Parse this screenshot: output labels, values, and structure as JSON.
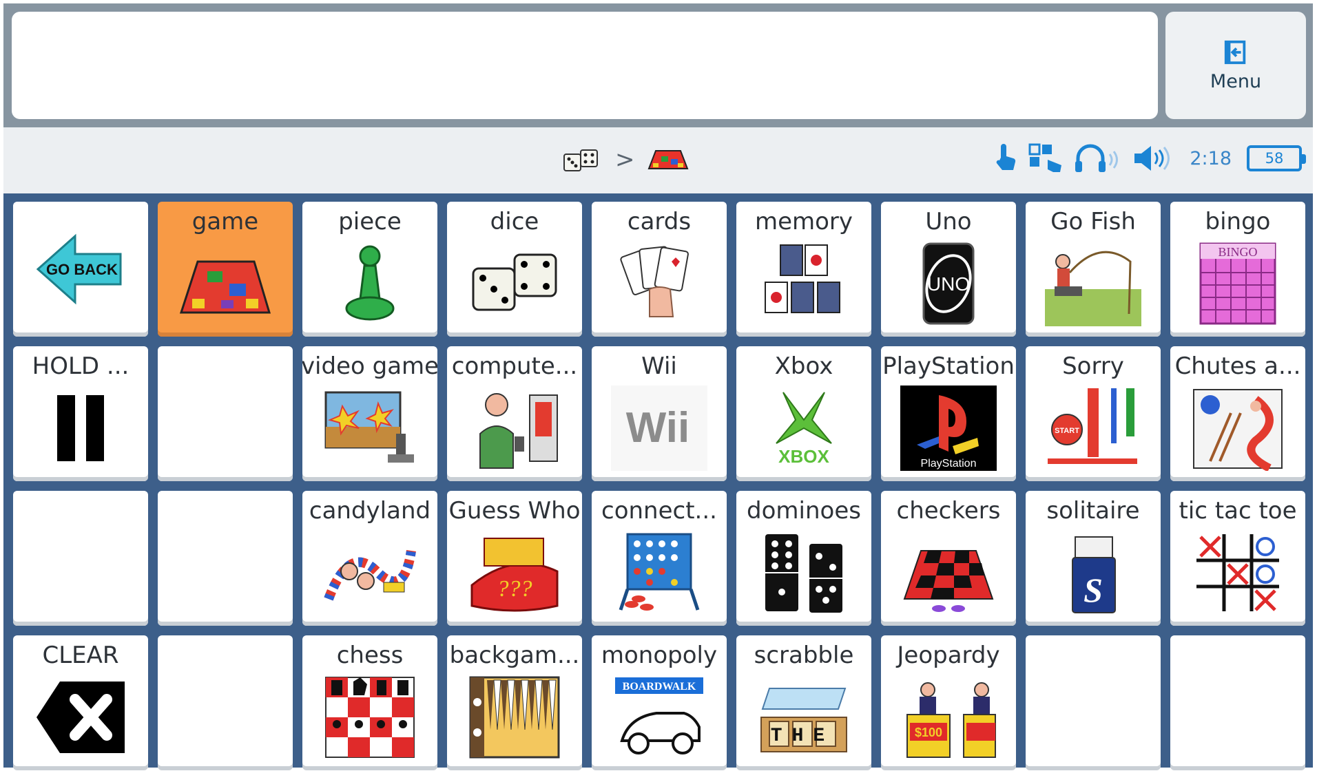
{
  "menu": {
    "label": "Menu",
    "icon": "exit-icon"
  },
  "breadcrumb": {
    "items": [
      "dice-icon",
      "game-board-icon"
    ],
    "separator": ">"
  },
  "status": {
    "time": "2:18",
    "battery": "58"
  },
  "tiles": [
    {
      "label": "",
      "icon": "go-back-arrow-icon",
      "text_in_image": "GO BACK"
    },
    {
      "label": "game",
      "icon": "game-board-icon",
      "highlight": "#f89a45"
    },
    {
      "label": "piece",
      "icon": "game-piece-icon"
    },
    {
      "label": "dice",
      "icon": "dice-icon"
    },
    {
      "label": "cards",
      "icon": "playing-cards-icon"
    },
    {
      "label": "memory",
      "icon": "memory-cards-icon"
    },
    {
      "label": "Uno",
      "icon": "uno-card-icon",
      "text_in_image": "UNO"
    },
    {
      "label": "Go Fish",
      "icon": "fishing-icon"
    },
    {
      "label": "bingo",
      "icon": "bingo-card-icon",
      "text_in_image": "BINGO"
    },
    {
      "label": "HOLD ...",
      "icon": "pause-icon"
    },
    {
      "label": "",
      "icon": ""
    },
    {
      "label": "video game",
      "icon": "video-game-icon"
    },
    {
      "label": "compute...",
      "icon": "computer-game-icon"
    },
    {
      "label": "Wii",
      "icon": "wii-logo-icon",
      "text_in_image": "Wii"
    },
    {
      "label": "Xbox",
      "icon": "xbox-logo-icon",
      "text_in_image": "XBOX"
    },
    {
      "label": "PlayStation",
      "icon": "playstation-logo-icon",
      "text_in_image": "PlayStation"
    },
    {
      "label": "Sorry",
      "icon": "sorry-board-icon",
      "text_in_image": "START"
    },
    {
      "label": "Chutes a...",
      "icon": "chutes-ladders-icon"
    },
    {
      "label": "",
      "icon": ""
    },
    {
      "label": "",
      "icon": ""
    },
    {
      "label": "candyland",
      "icon": "candyland-icon"
    },
    {
      "label": "Guess Who",
      "icon": "guess-who-icon",
      "text_in_image": "???"
    },
    {
      "label": "connect...",
      "icon": "connect-four-icon"
    },
    {
      "label": "dominoes",
      "icon": "dominoes-icon"
    },
    {
      "label": "checkers",
      "icon": "checkers-board-icon"
    },
    {
      "label": "solitaire",
      "icon": "solitaire-icon",
      "text_in_image": "S"
    },
    {
      "label": "tic tac toe",
      "icon": "tic-tac-toe-icon"
    },
    {
      "label": "CLEAR",
      "icon": "clear-x-icon"
    },
    {
      "label": "",
      "icon": ""
    },
    {
      "label": "chess",
      "icon": "chess-board-icon"
    },
    {
      "label": "backgam...",
      "icon": "backgammon-icon"
    },
    {
      "label": "monopoly",
      "icon": "monopoly-car-icon",
      "text_in_image": "BOARDWALK"
    },
    {
      "label": "scrabble",
      "icon": "scrabble-icon",
      "text_in_image": "THE"
    },
    {
      "label": "Jeopardy",
      "icon": "jeopardy-icon",
      "text_in_image": "$100"
    },
    {
      "label": "",
      "icon": ""
    },
    {
      "label": "",
      "icon": ""
    }
  ],
  "colors": {
    "top_bar": "#8795a1",
    "grid_bg": "#3d5f8a",
    "accent": "#1b84d4",
    "highlight": "#f89a45"
  }
}
